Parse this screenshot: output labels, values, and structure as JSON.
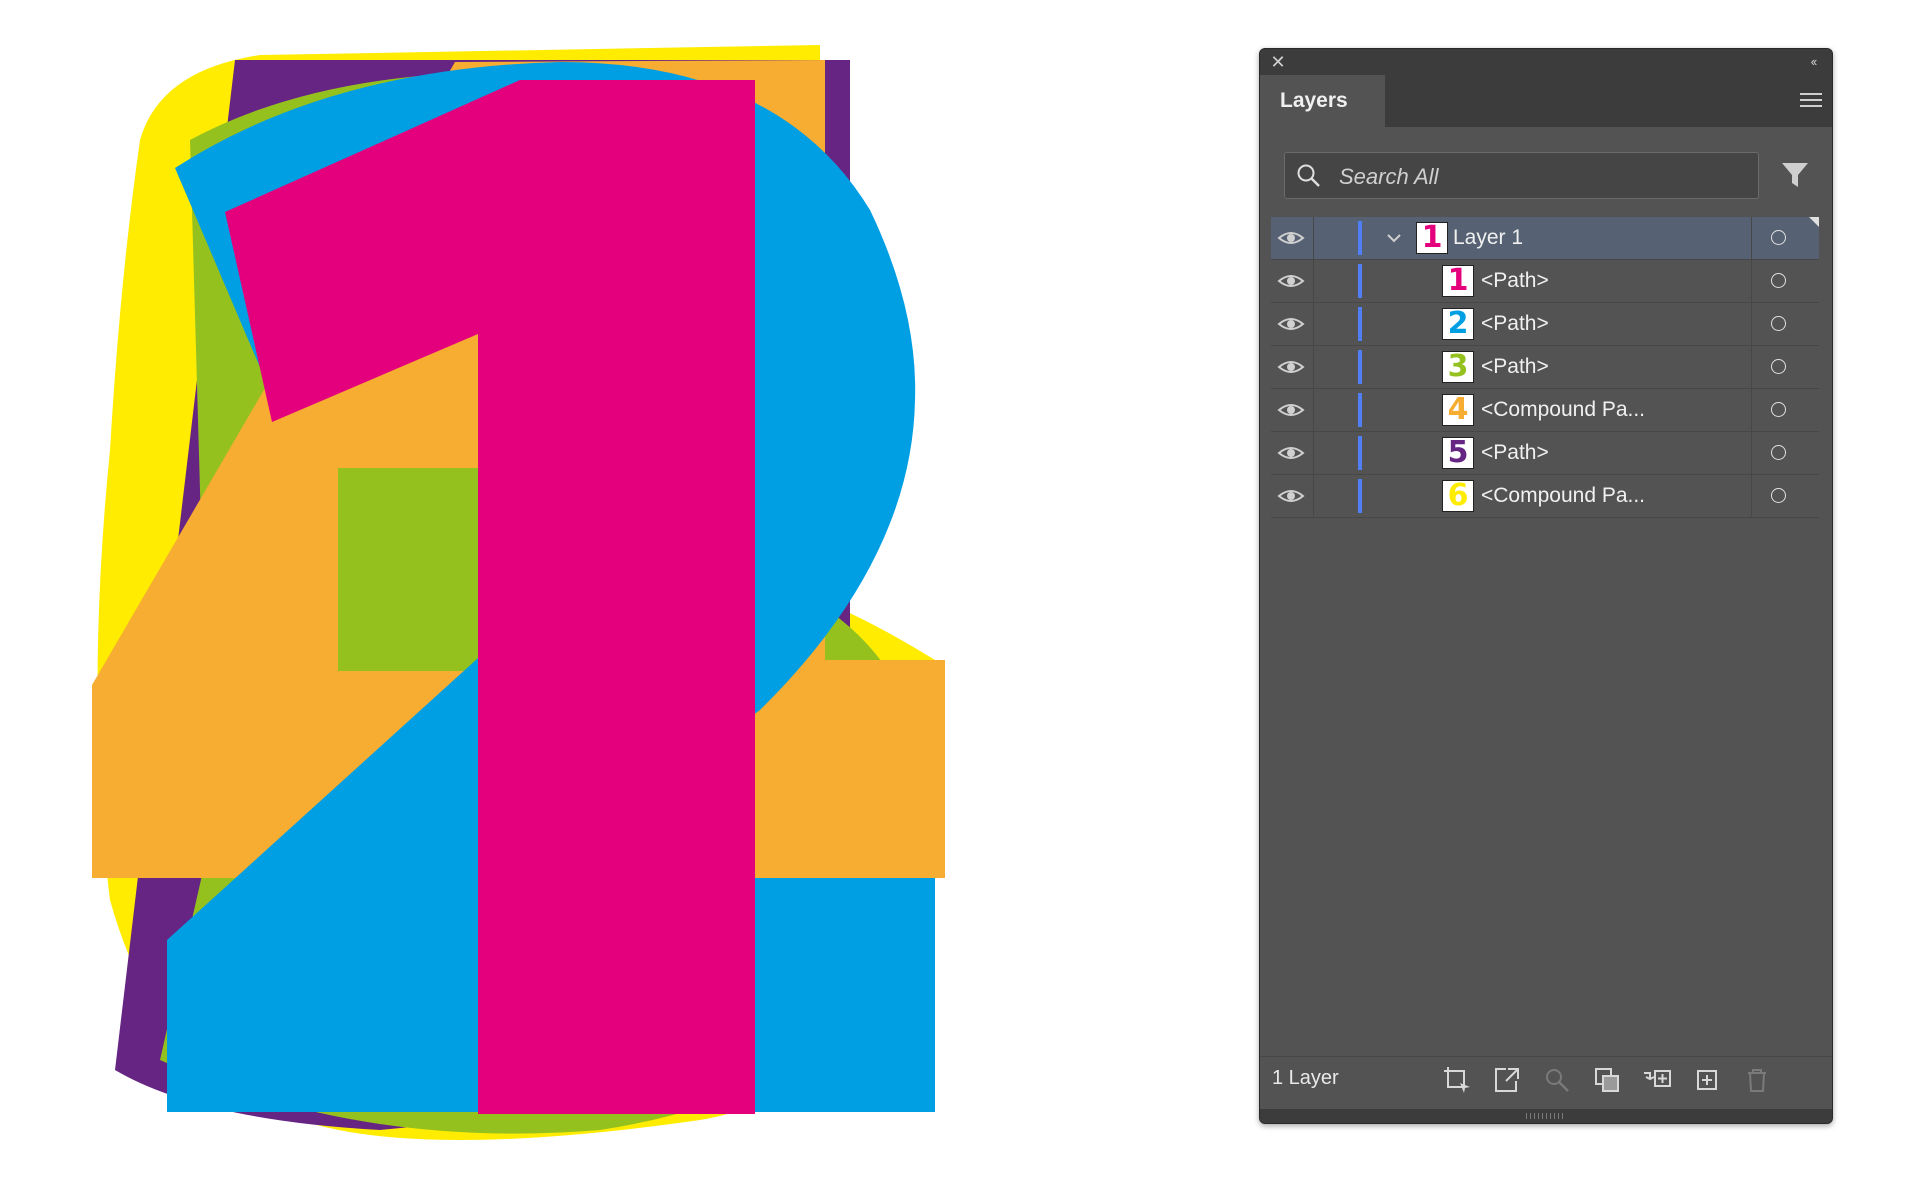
{
  "panel": {
    "tab_label": "Layers",
    "search": {
      "placeholder": "Search All"
    },
    "rows": [
      {
        "label": "Layer 1",
        "thumb": "1",
        "thumb_color": "#e4007c",
        "kind": "layer",
        "expanded": true,
        "selected": true
      },
      {
        "label": "<Path>",
        "thumb": "1",
        "thumb_color": "#e4007c",
        "kind": "sublayer"
      },
      {
        "label": "<Path>",
        "thumb": "2",
        "thumb_color": "#009fe3",
        "kind": "sublayer"
      },
      {
        "label": "<Path>",
        "thumb": "3",
        "thumb_color": "#95c11f",
        "kind": "sublayer"
      },
      {
        "label": "<Compound Pa...",
        "thumb": "4",
        "thumb_color": "#f7ac32",
        "kind": "sublayer"
      },
      {
        "label": "<Path>",
        "thumb": "5",
        "thumb_color": "#662483",
        "kind": "sublayer"
      },
      {
        "label": "<Compound Pa...",
        "thumb": "6",
        "thumb_color": "#ffec00",
        "kind": "sublayer"
      }
    ],
    "footer": {
      "layer_count": "1 Layer"
    },
    "layer_color": "#4f7ef5"
  },
  "artwork_colors": {
    "magenta": "#e4007c",
    "cyan": "#009fe3",
    "green": "#95c11f",
    "orange": "#f7ac32",
    "purple": "#662483",
    "yellow": "#ffec00"
  }
}
